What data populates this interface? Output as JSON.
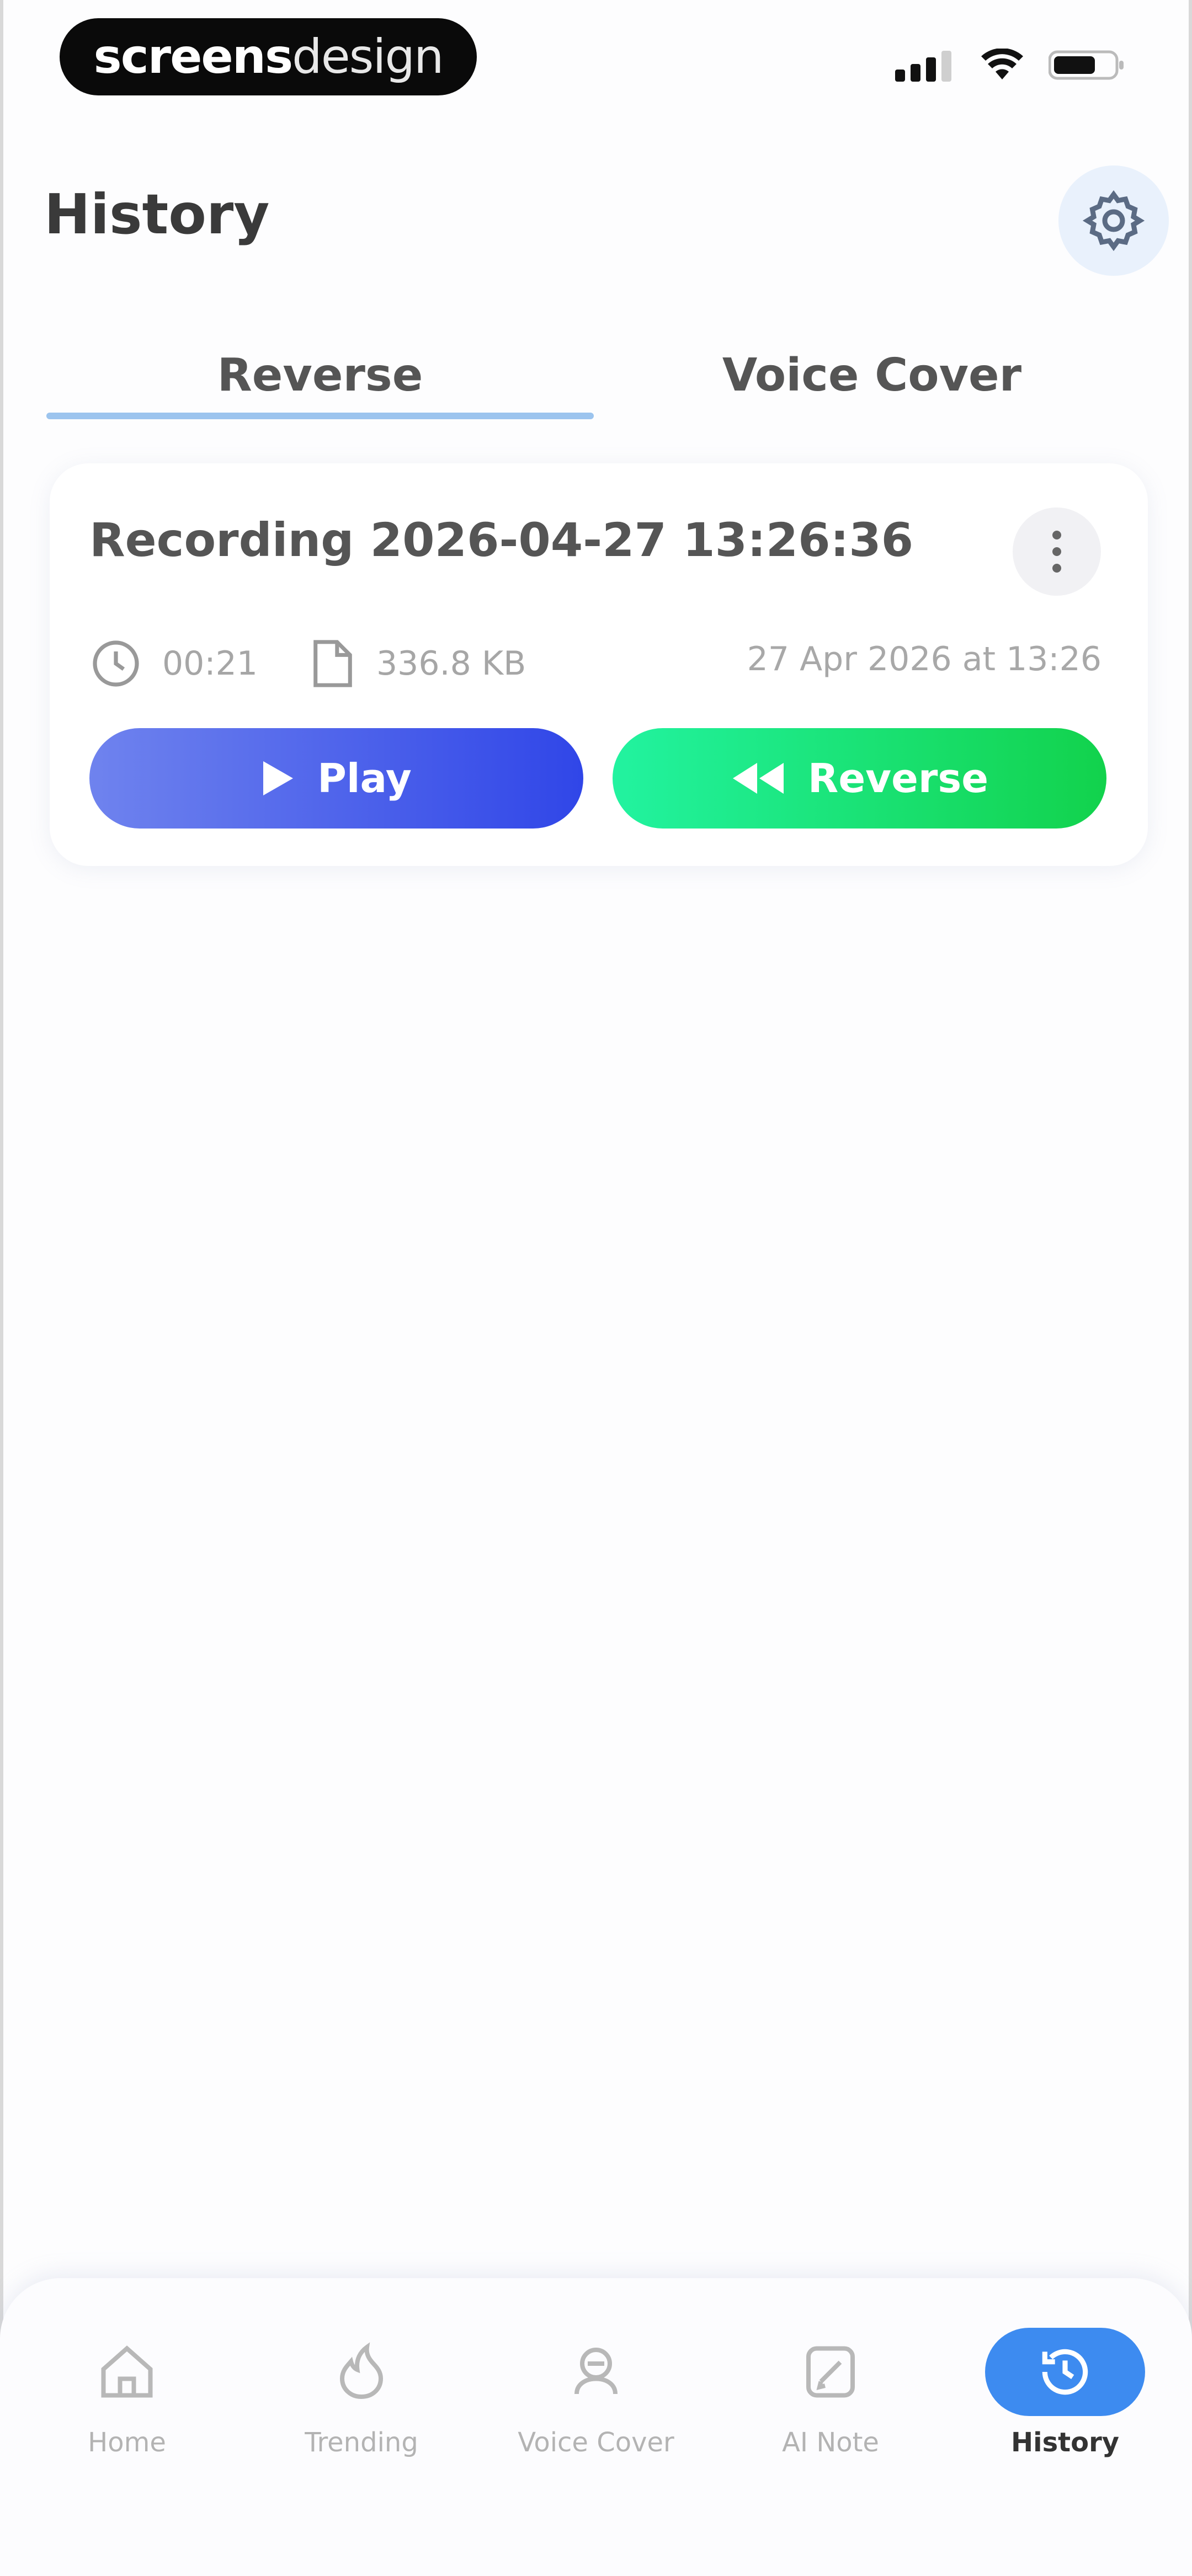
{
  "status_bar": {
    "badge_bold": "screens",
    "badge_light": "design"
  },
  "header": {
    "title": "History"
  },
  "tabs": [
    {
      "label": "Reverse",
      "active": true
    },
    {
      "label": "Voice Cover",
      "active": false
    }
  ],
  "recording": {
    "title": "Recording 2026-04-27 13:26:36",
    "duration": "00:21",
    "size": "336.8 KB",
    "date": "27 Apr 2026 at 13:26",
    "play_label": "Play",
    "reverse_label": "Reverse"
  },
  "bottom_nav": [
    {
      "label": "Home",
      "icon": "home-icon"
    },
    {
      "label": "Trending",
      "icon": "flame-icon"
    },
    {
      "label": "Voice Cover",
      "icon": "mic-icon"
    },
    {
      "label": "AI Note",
      "icon": "note-icon"
    },
    {
      "label": "History",
      "icon": "history-icon",
      "active": true
    }
  ],
  "colors": {
    "accent": "#3d8bf0",
    "play_gradient_start": "#6f83ee",
    "play_gradient_end": "#3046e8",
    "reverse_gradient_start": "#22f3a0",
    "reverse_gradient_end": "#12d24c"
  }
}
